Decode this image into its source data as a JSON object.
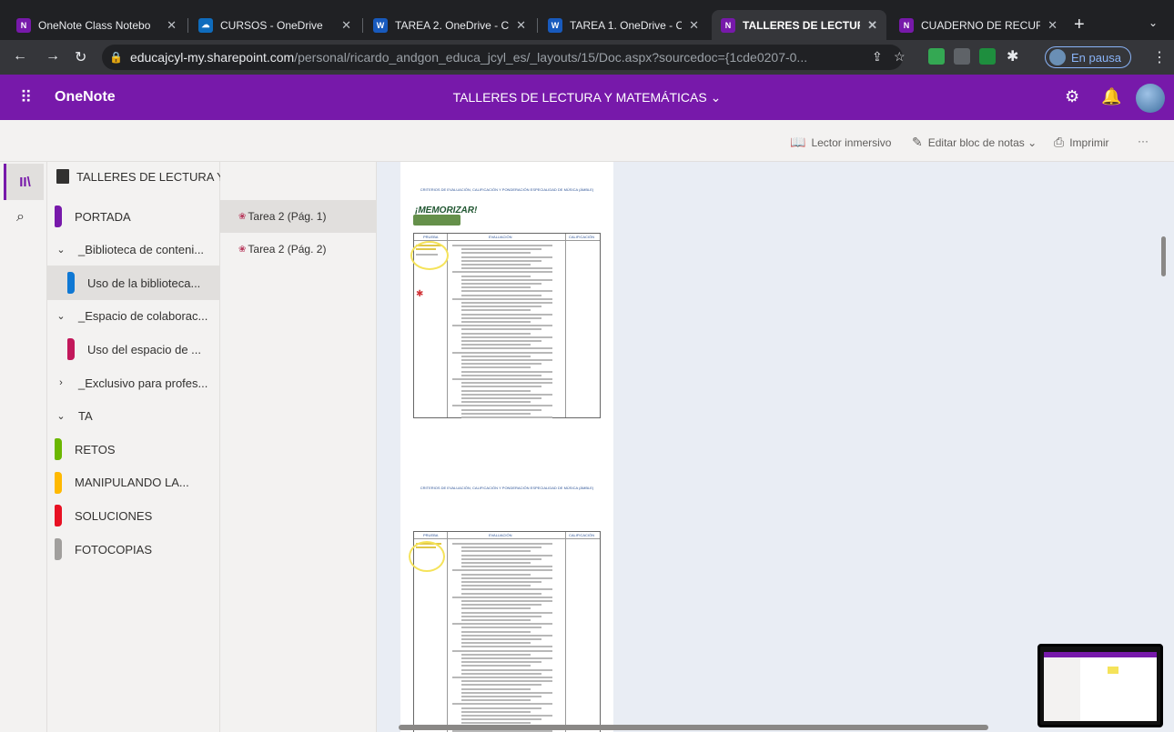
{
  "browser": {
    "tabs": [
      {
        "title": "OneNote Class Notebo",
        "favicon_color": "#7719aa",
        "favicon_text": "N",
        "active": false
      },
      {
        "title": "CURSOS - OneDrive",
        "favicon_color": "#0f6cbd",
        "favicon_text": "☁",
        "active": false
      },
      {
        "title": "TAREA 2. OneDrive - C",
        "favicon_color": "#185abd",
        "favicon_text": "W",
        "active": false
      },
      {
        "title": "TAREA 1. OneDrive - C",
        "favicon_color": "#185abd",
        "favicon_text": "W",
        "active": false
      },
      {
        "title": "TALLERES DE LECTUR",
        "favicon_color": "#7719aa",
        "favicon_text": "N",
        "active": true
      },
      {
        "title": "CUADERNO DE RECUR",
        "favicon_color": "#7719aa",
        "favicon_text": "N",
        "active": false
      }
    ],
    "url_host": "educajcyl-my.sharepoint.com",
    "url_path": "/personal/ricardo_andgon_educa_jcyl_es/_layouts/15/Doc.aspx?sourcedoc={1cde0207-0...",
    "profile_label": "En pausa"
  },
  "app": {
    "name": "OneNote",
    "notebook_title": "TALLERES DE LECTURA Y MATEMÁTICAS ⌄",
    "accent_color": "#7719aa"
  },
  "commands": {
    "immersive_reader": "Lector inmersivo",
    "edit_notebook": "Editar bloc de notas ⌄",
    "print": "Imprimir",
    "more": "···"
  },
  "sections_panel": {
    "notebook_name": "TALLERES DE LECTURA Y MATEMÁTICAS",
    "items": [
      {
        "label": "PORTADA",
        "color": "#7719aa",
        "kind": "section",
        "selected": false
      },
      {
        "label": "_Biblioteca de conteni...",
        "kind": "group",
        "caret": "⌄"
      },
      {
        "label": "Uso de la biblioteca...",
        "color": "#0f78d4",
        "kind": "section",
        "selected": true
      },
      {
        "label": "_Espacio de colaborac...",
        "kind": "group",
        "caret": "⌄"
      },
      {
        "label": "Uso del espacio de ...",
        "color": "#c2185b",
        "kind": "section",
        "selected": false
      },
      {
        "label": "_Exclusivo para profes...",
        "kind": "group",
        "caret": "›"
      },
      {
        "label": "TA",
        "kind": "group",
        "caret": "⌄"
      },
      {
        "label": "RETOS",
        "color": "#6bb700",
        "kind": "section",
        "selected": false
      },
      {
        "label": "MANIPULANDO LA...",
        "color": "#ffb900",
        "kind": "section",
        "selected": false
      },
      {
        "label": "SOLUCIONES",
        "color": "#e81123",
        "kind": "section",
        "selected": false
      },
      {
        "label": "FOTOCOPIAS",
        "color": "#a19f9d",
        "kind": "section",
        "selected": false
      }
    ]
  },
  "pages_panel": {
    "items": [
      {
        "label": "Tarea 2 (Pág. 1)",
        "selected": true
      },
      {
        "label": "Tarea 2 (Pág. 2)",
        "selected": false
      }
    ]
  },
  "document": {
    "page1_title": "CRITERIOS DE EVALUACIÓN, CALIFICACIÓN Y PONDERACIÓN ESPECIALIDAD DE MÚSICA (ÁMBLE)",
    "memorizar": "¡MEMORIZAR!",
    "page2_title": "CRITERIOS DE EVALUACIÓN, CALIFICACIÓN Y PONDERACIÓN ESPECIALIDAD DE MÚSICA (ÁMBLE)",
    "col1": "PRUEBA",
    "col2": "EVALUACIÓN",
    "col3": "CALIFICACIÓN"
  }
}
